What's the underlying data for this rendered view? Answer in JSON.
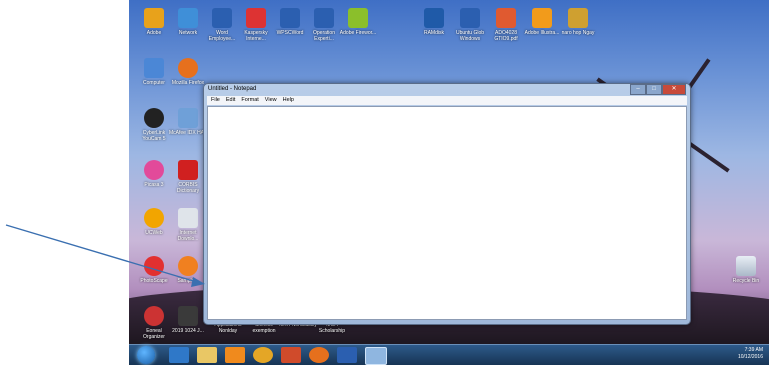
{
  "desktop_icons": [
    {
      "label": "Adobe",
      "color": "#e8a21b"
    },
    {
      "label": "Network",
      "color": "#3f8fd8"
    },
    {
      "label": "Word Employee...",
      "color": "#2b5fb0"
    },
    {
      "label": "Kaspersky Interne...",
      "color": "#d33"
    },
    {
      "label": "WPSCWord",
      "color": "#2b5fb0"
    },
    {
      "label": "Operation Experti...",
      "color": "#2b5fb0"
    },
    {
      "label": "Adobe Firewor...",
      "color": "#8bbf2b"
    },
    {
      "label": "Computer",
      "color": "#4b87d6"
    },
    {
      "label": "Mozilla Firefox",
      "color": "#e6701d"
    },
    {
      "label": "CyberLink YouCam 5",
      "color": "#222"
    },
    {
      "label": "McAfee IDX HAV",
      "color": "#6fa0d8"
    },
    {
      "label": "Picasa 3",
      "color": "#e24a9a"
    },
    {
      "label": "CORBIS Dictionary",
      "color": "#d02020"
    },
    {
      "label": "UCWeb",
      "color": "#f2a500"
    },
    {
      "label": "Internet Downlo...",
      "color": "#dfe4ea"
    },
    {
      "label": "PhotoScape",
      "color": "#e23030"
    },
    {
      "label": "Sample...",
      "color": "#f08020"
    },
    {
      "label": "Eoneal Organizer",
      "color": "#c33"
    },
    {
      "label": "2019 1024 J...",
      "color": "#3a3a3a"
    }
  ],
  "top_row_right": [
    {
      "label": "RAMdisk",
      "color": "#1f5aa8"
    },
    {
      "label": "Ubuntu Glob Windows",
      "color": "#2b5fb0"
    },
    {
      "label": "ADO4028 GTIO9.pdf",
      "color": "#e05a30"
    },
    {
      "label": "Adobe Illustra...",
      "color": "#f29b1b"
    },
    {
      "label": "naro hop Ngay",
      "color": "#cfa030"
    }
  ],
  "bottom_icons": [
    {
      "label": "Applications Nonlday"
    },
    {
      "label": "Chinese exemption"
    },
    {
      "label": "MKH Nonlclassly"
    },
    {
      "label": "MOA Scholarship"
    }
  ],
  "recycle_bin": {
    "label": "Recycle Bin"
  },
  "notepad": {
    "title": "Untitled - Notepad",
    "menu": [
      "File",
      "Edit",
      "Format",
      "View",
      "Help"
    ],
    "min": "–",
    "max": "□",
    "close": "✕",
    "content": ""
  },
  "taskbar": {
    "time": "7:39 AM",
    "date": "10/12/2016",
    "apps": [
      "ie",
      "explorer",
      "media",
      "chrome",
      "powerpoint",
      "firefox",
      "word",
      "notepad"
    ]
  },
  "colors": {
    "arrow": "#3a6fb0"
  }
}
